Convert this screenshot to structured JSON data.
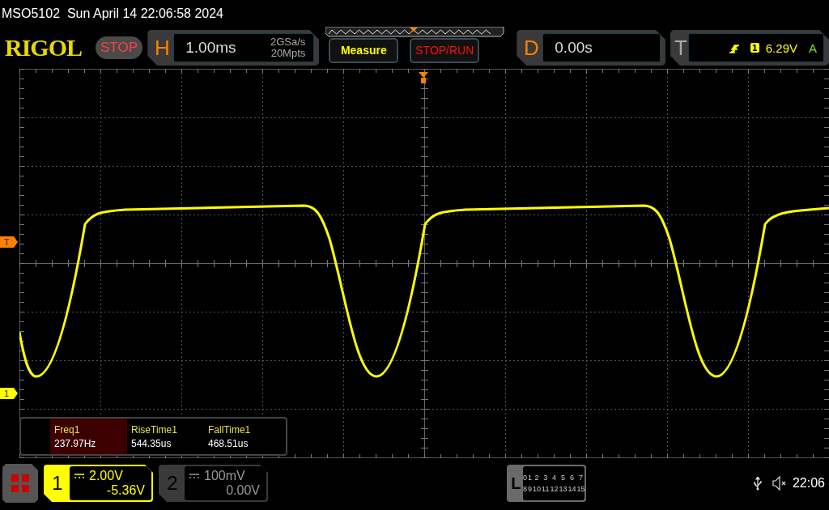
{
  "status_bar": {
    "title": "MSO5102  Sun April 14 22:06:58 2024"
  },
  "header": {
    "logo": "RIGOL",
    "run_state": {
      "label": "STOP",
      "kind": "stop"
    },
    "horizontal": {
      "label": "H",
      "timebase": "1.00ms",
      "sample_rate": "2GSa/s",
      "memory_depth": "20Mpts"
    },
    "buttons": [
      {
        "label": "Measure",
        "kind": "measure"
      },
      {
        "label": "STOP/RUN",
        "kind": "run"
      }
    ],
    "delay": {
      "label": "D",
      "value": "0.00s"
    },
    "trigger": {
      "label": "T",
      "source": "1",
      "threshold": "6.29V",
      "mode": "A"
    }
  },
  "markers": [
    {
      "label": "T",
      "kind": "trigger"
    },
    {
      "label": "1",
      "kind": "channel"
    }
  ],
  "measurements": [
    {
      "name": "Freq1",
      "value": "237.97Hz",
      "selected": true
    },
    {
      "name": "RiseTime1",
      "value": "544.35us",
      "selected": false
    },
    {
      "name": "FallTime1",
      "value": "468.51us",
      "selected": false
    }
  ],
  "channels": [
    {
      "number": "1",
      "scale": "2.00V",
      "offset": "-5.36V",
      "active": true
    },
    {
      "number": "2",
      "scale": "100mV",
      "offset": "0.00V",
      "active": false
    }
  ],
  "logic": {
    "label": "L",
    "bits": [
      "0",
      "1",
      "2",
      "3",
      "4",
      "5",
      "6",
      "7",
      "8",
      "9",
      "10",
      "11",
      "12",
      "13",
      "14",
      "15"
    ]
  },
  "system": {
    "time": "22:06"
  }
}
